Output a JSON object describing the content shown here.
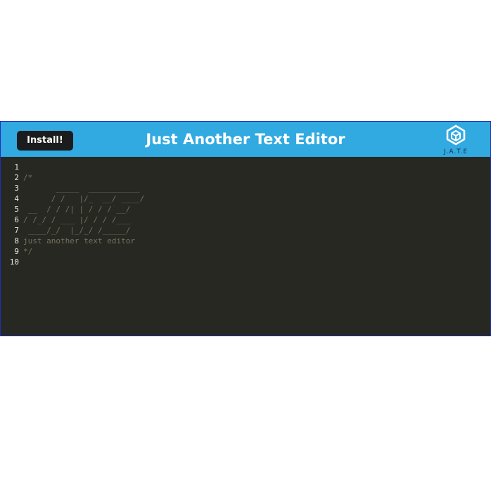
{
  "navbar": {
    "install_label": "Install!",
    "title": "Just Another Text Editor",
    "logo_text": "J.A.T.E",
    "logo_icon": "cube-icon"
  },
  "editor": {
    "lines": [
      "",
      "/*",
      "       _____  ___________",
      "      / /   |/_  __/ ____/",
      " __  / / /| | / / / __/",
      "/ /_/ / ___ |/ / / /___",
      " ____/_/  |_/_/ /_____/",
      "just another text editor",
      "*/",
      ""
    ]
  },
  "colors": {
    "navbar_bg": "#31a9e1",
    "editor_bg": "#272822",
    "comment": "#75715e",
    "line_number": "#e8e8e2",
    "button_bg": "#1b1c1e"
  }
}
